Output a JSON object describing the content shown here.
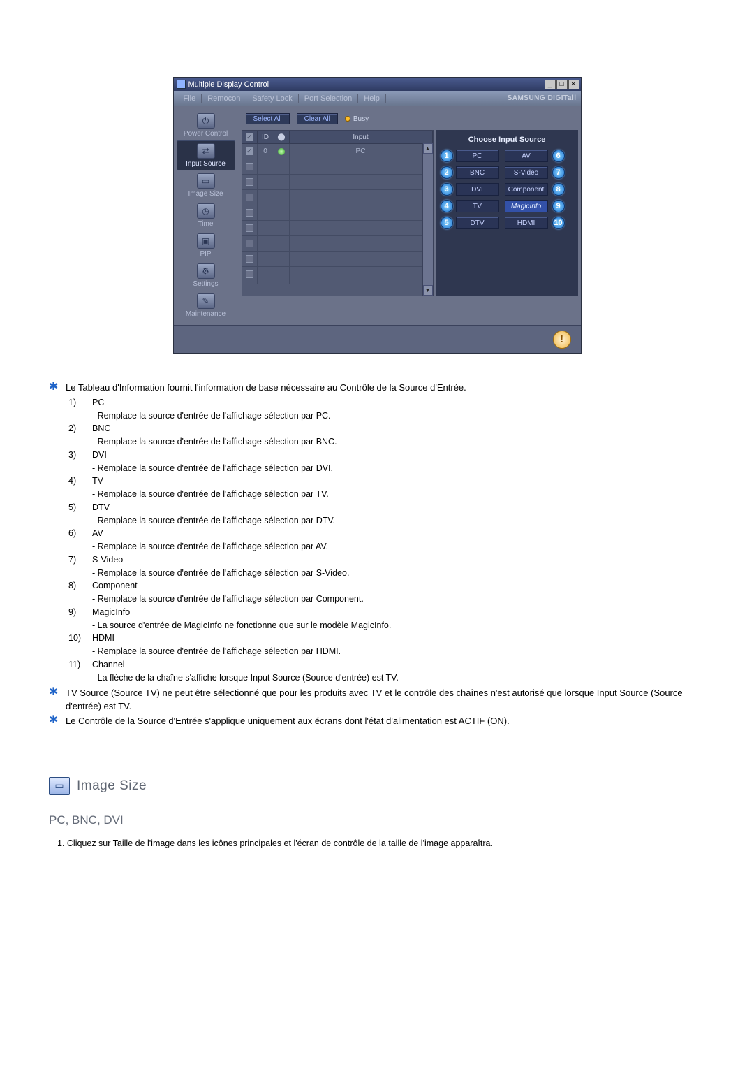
{
  "window": {
    "title": "Multiple Display Control",
    "menus": [
      "File",
      "Remocon",
      "Safety Lock",
      "Port Selection",
      "Help"
    ],
    "brand": "SAMSUNG DIGITall"
  },
  "sidebar_items": [
    {
      "label": "Power Control"
    },
    {
      "label": "Input Source"
    },
    {
      "label": "Image Size"
    },
    {
      "label": "Time"
    },
    {
      "label": "PIP"
    },
    {
      "label": "Settings"
    },
    {
      "label": "Maintenance"
    }
  ],
  "toolbar": {
    "select_all": "Select All",
    "clear_all": "Clear All",
    "busy": "Busy"
  },
  "table": {
    "headers": {
      "chk": "☑",
      "id": "ID",
      "lamp": "",
      "input": "Input"
    },
    "first_row": {
      "id": "0",
      "input": "PC"
    }
  },
  "right_panel": {
    "title": "Choose Input Source",
    "left_col": [
      {
        "n": "1",
        "label": "PC"
      },
      {
        "n": "2",
        "label": "BNC"
      },
      {
        "n": "3",
        "label": "DVI"
      },
      {
        "n": "4",
        "label": "TV"
      },
      {
        "n": "5",
        "label": "DTV"
      }
    ],
    "right_col": [
      {
        "n": "6",
        "label": "AV"
      },
      {
        "n": "7",
        "label": "S-Video"
      },
      {
        "n": "8",
        "label": "Component"
      },
      {
        "n": "9",
        "label": "MagicInfo",
        "magic": true
      },
      {
        "n": "10",
        "label": "HDMI"
      }
    ]
  },
  "intro_star": "Le Tableau d'Information fournit l'information de base nécessaire au Contrôle de la Source d'Entrée.",
  "items": [
    {
      "n": "1)",
      "t": "PC",
      "d": "- Remplace la source d'entrée de l'affichage sélection par PC."
    },
    {
      "n": "2)",
      "t": "BNC",
      "d": "- Remplace la source d'entrée de l'affichage sélection par BNC."
    },
    {
      "n": "3)",
      "t": "DVI",
      "d": "- Remplace la source d'entrée de l'affichage sélection par DVI."
    },
    {
      "n": "4)",
      "t": "TV",
      "d": "- Remplace la source d'entrée de l'affichage sélection par TV."
    },
    {
      "n": "5)",
      "t": "DTV",
      "d": "- Remplace la source d'entrée de l'affichage sélection par DTV."
    },
    {
      "n": "6)",
      "t": "AV",
      "d": "- Remplace la source d'entrée de l'affichage sélection par AV."
    },
    {
      "n": "7)",
      "t": "S-Video",
      "d": "- Remplace la source d'entrée de l'affichage sélection par S-Video."
    },
    {
      "n": "8)",
      "t": "Component",
      "d": "- Remplace la source d'entrée de l'affichage sélection par Component."
    },
    {
      "n": "9)",
      "t": "MagicInfo",
      "d": "- La source d'entrée de MagicInfo ne fonctionne que sur le modèle MagicInfo."
    },
    {
      "n": "10)",
      "t": "HDMI",
      "d": "- Remplace la source d'entrée de l'affichage sélection par HDMI."
    },
    {
      "n": "11)",
      "t": "Channel",
      "d": "- La flèche de la chaîne s'affiche lorsque Input Source (Source d'entrée) est TV."
    }
  ],
  "note1": "TV Source (Source TV) ne peut être sélectionné que pour les produits avec TV et le contrôle des chaînes n'est autorisé que lorsque Input Source (Source d'entrée) est TV.",
  "note2": "Le Contrôle de la Source d'Entrée s'applique uniquement aux écrans dont l'état d'alimentation est ACTIF (ON).",
  "sec2": {
    "title": "Image Size",
    "subtitle": "PC, BNC, DVI",
    "line": "1.  Cliquez sur Taille de l'image dans les icônes principales et l'écran de contrôle de la taille de l'image apparaîtra."
  }
}
